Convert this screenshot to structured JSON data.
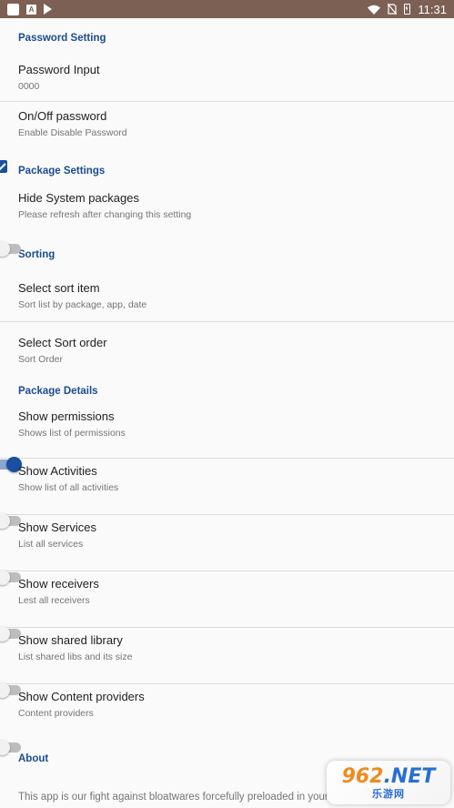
{
  "status_bar": {
    "time": "11:31",
    "left_icons": [
      "app-square-icon",
      "a-badge-icon",
      "play-store-icon"
    ],
    "right_icons": [
      "wifi-icon",
      "no-sim-icon",
      "battery-icon"
    ]
  },
  "sections": [
    {
      "title": "Password Setting",
      "items": [
        {
          "title": "Password Input",
          "summary": "0000",
          "widget": "none"
        },
        {
          "title": "On/Off password",
          "summary": "Enable Disable Password",
          "widget": "checkbox",
          "checked": true
        }
      ]
    },
    {
      "title": "Package Settings",
      "items": [
        {
          "title": "Hide System packages",
          "summary": "Please refresh after changing this setting",
          "widget": "switch",
          "checked": false
        }
      ]
    },
    {
      "title": "Sorting",
      "items": [
        {
          "title": "Select sort item",
          "summary": "Sort list by package, app, date",
          "widget": "none"
        },
        {
          "title": "Select Sort order",
          "summary": "Sort Order",
          "widget": "none"
        }
      ]
    },
    {
      "title": "Package Details",
      "items": [
        {
          "title": "Show permissions",
          "summary": "Shows list of permissions",
          "widget": "switch",
          "checked": true
        },
        {
          "title": "Show Activities",
          "summary": "Show list of all activities",
          "widget": "switch",
          "checked": false
        },
        {
          "title": "Show Services",
          "summary": "List all services",
          "widget": "switch",
          "checked": false
        },
        {
          "title": "Show receivers",
          "summary": "Lest all receivers",
          "widget": "switch",
          "checked": false
        },
        {
          "title": "Show shared library",
          "summary": "List shared libs and its size",
          "widget": "switch",
          "checked": false
        },
        {
          "title": "Show Content providers",
          "summary": "Content providers",
          "widget": "switch",
          "checked": false
        }
      ]
    },
    {
      "title": "About",
      "text": "This app is our fight against bloatwares forcefully preloaded in your phone"
    }
  ],
  "watermark": {
    "brand": "962",
    "domain": ".NET",
    "subtitle": "乐游网"
  },
  "colors": {
    "status_bar": "#7d6054",
    "accent": "#1a4fa0",
    "category": "#1a4d8f"
  }
}
